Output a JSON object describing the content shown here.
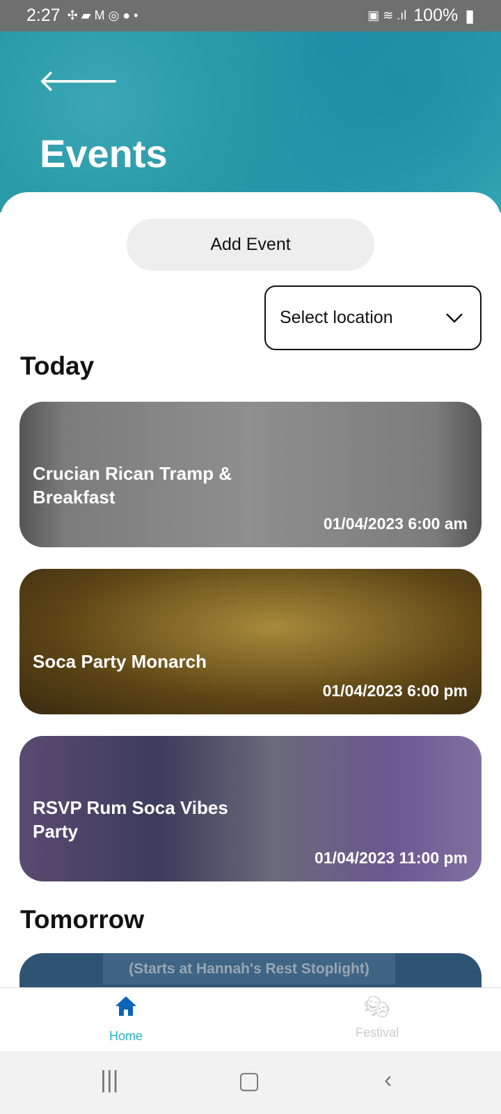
{
  "status_bar": {
    "time": "2:27",
    "battery": "100%"
  },
  "header": {
    "title": "Events"
  },
  "actions": {
    "add_event": "Add Event",
    "location_placeholder": "Select location"
  },
  "sections": [
    {
      "title": "Today",
      "events": [
        {
          "name": "Crucian Rican Tramp & Breakfast",
          "datetime": "01/04/2023 6:00 am"
        },
        {
          "name": "Soca Party Monarch",
          "datetime": "01/04/2023 6:00 pm"
        },
        {
          "name": "RSVP Rum Soca Vibes Party",
          "datetime": "01/04/2023 11:00 pm"
        }
      ]
    },
    {
      "title": "Tomorrow",
      "events": [
        {
          "image_text": "(Starts at Hannah's Rest Stoplight)"
        }
      ]
    }
  ],
  "bottom_nav": [
    {
      "label": "Home",
      "icon": "home-icon",
      "active": true,
      "color": "#1fb5c9",
      "icon_color": "#0a64b8"
    },
    {
      "label": "Festival",
      "icon": "theater-masks-icon",
      "active": false,
      "color": "#cccccc"
    }
  ]
}
